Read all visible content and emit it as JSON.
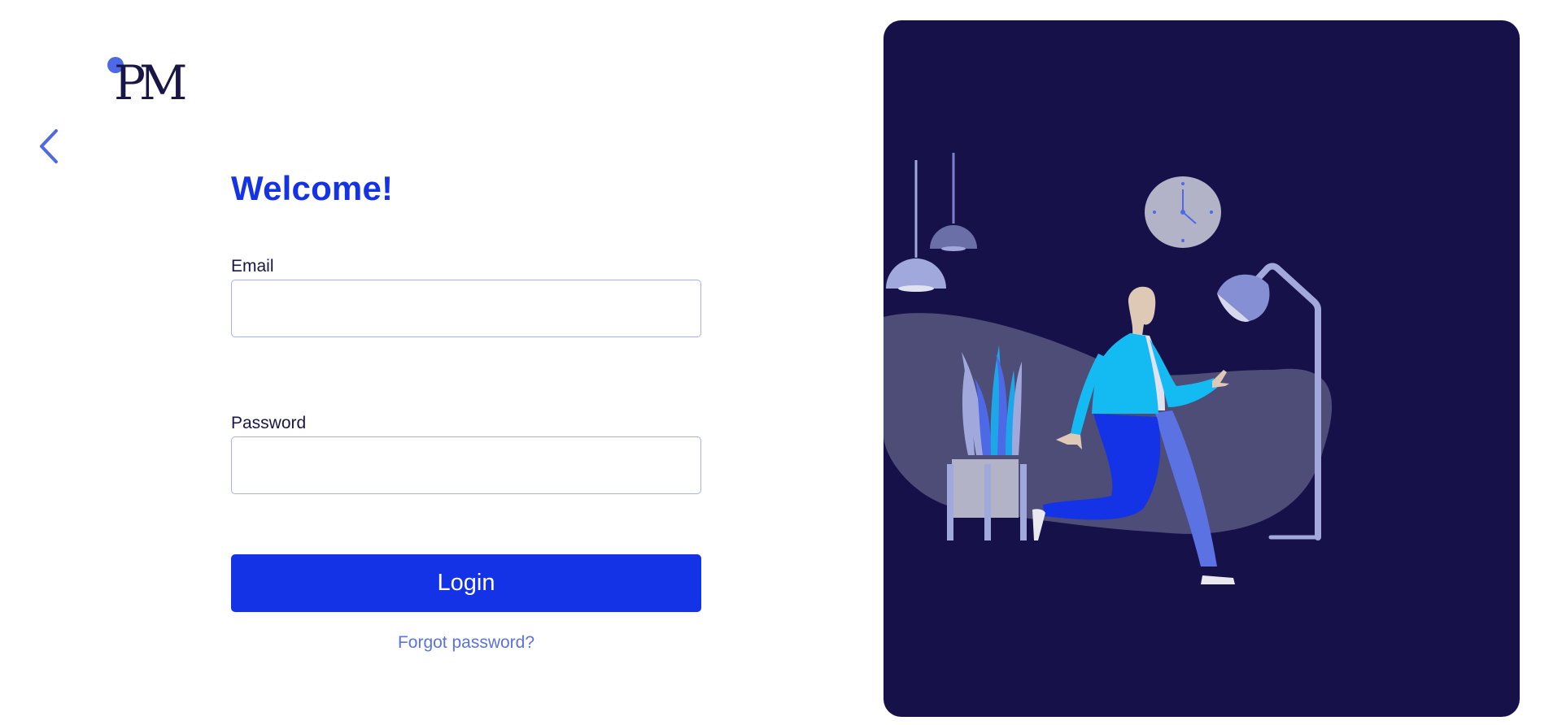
{
  "brand": {
    "logo_text": "PM",
    "accent_color": "#1433e6",
    "logo_dot_color": "#4d69e6",
    "logo_text_color": "#1a1547"
  },
  "nav": {
    "back_icon": "chevron-left-icon"
  },
  "form": {
    "title": "Welcome!",
    "email": {
      "label": "Email",
      "value": "",
      "placeholder": ""
    },
    "password": {
      "label": "Password",
      "value": "",
      "placeholder": ""
    },
    "login_label": "Login",
    "forgot_label": "Forgot password?"
  },
  "illustration": {
    "background_color": "#161149",
    "icons": [
      "pendant-lamp-icon",
      "wall-clock-icon",
      "floor-lamp-icon",
      "potted-plant-icon",
      "walking-person-icon"
    ]
  }
}
